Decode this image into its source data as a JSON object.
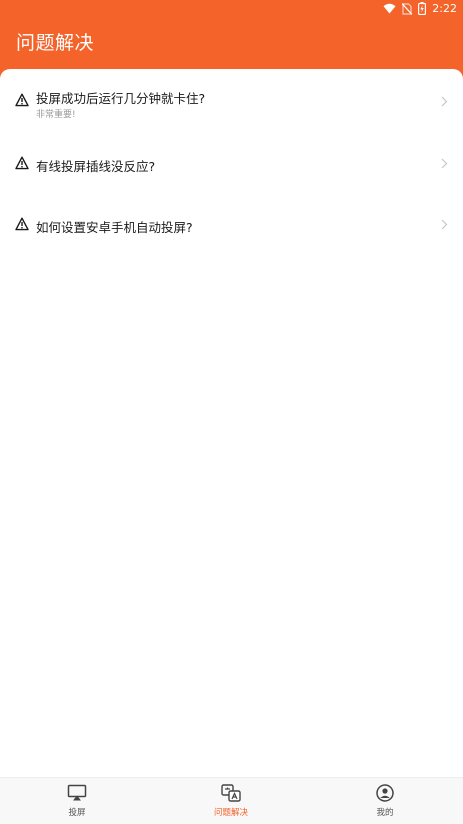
{
  "status_bar": {
    "time": "2:22",
    "icons": [
      "wifi-icon",
      "no-sim-icon",
      "battery-charging-icon"
    ]
  },
  "header": {
    "title": "问题解决"
  },
  "faq": {
    "items": [
      {
        "title": "投屏成功后运行几分钟就卡住?",
        "subtitle": "非常重要!"
      },
      {
        "title": "有线投屏插线没反应?"
      },
      {
        "title": "如何设置安卓手机自动投屏?"
      }
    ],
    "item_icon": "warning-icon",
    "chevron_icon": "chevron-right-icon"
  },
  "bottom_nav": {
    "items": [
      {
        "label": "投屏",
        "icon": "screen-cast-icon",
        "active": false
      },
      {
        "label": "问题解决",
        "icon": "translate-solve-icon",
        "active": true
      },
      {
        "label": "我的",
        "icon": "user-icon",
        "active": false
      }
    ]
  },
  "colors": {
    "accent": "#f3632a",
    "background": "#ffffff",
    "nav_background": "#f8f8f8",
    "text": "#1a1a1a",
    "subtext": "#9a9a9a"
  }
}
